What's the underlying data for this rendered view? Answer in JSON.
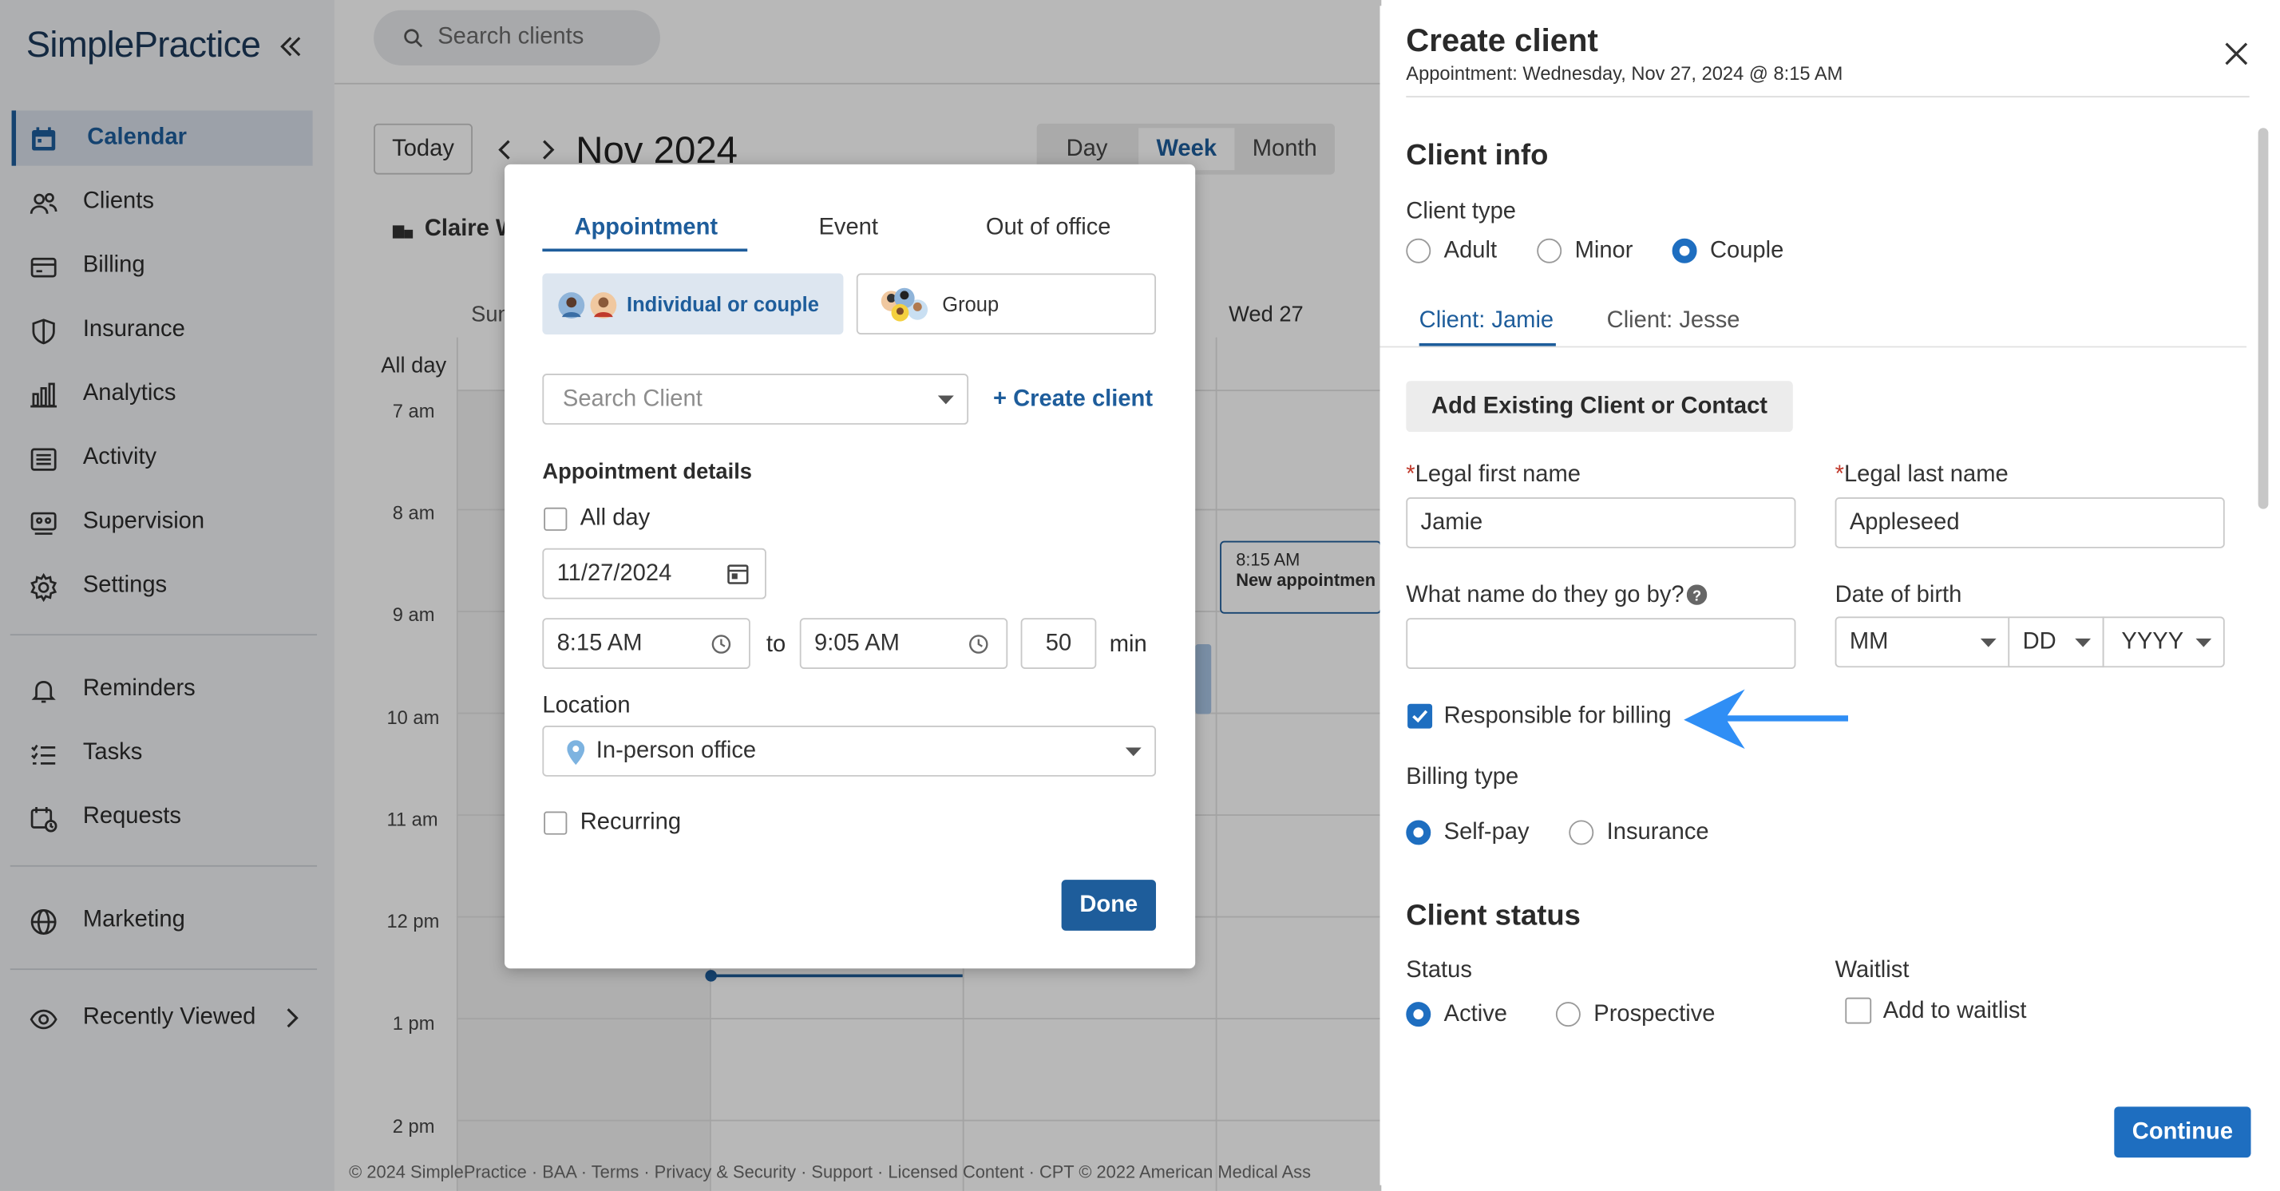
{
  "app": {
    "logo": "SimplePractice",
    "search_placeholder": "Search clients"
  },
  "sidebar": {
    "items": [
      {
        "label": "Calendar",
        "icon": "calendar-icon"
      },
      {
        "label": "Clients",
        "icon": "clients-icon"
      },
      {
        "label": "Billing",
        "icon": "billing-icon"
      },
      {
        "label": "Insurance",
        "icon": "shield-icon"
      },
      {
        "label": "Analytics",
        "icon": "analytics-icon"
      },
      {
        "label": "Activity",
        "icon": "activity-icon"
      },
      {
        "label": "Supervision",
        "icon": "supervision-icon"
      },
      {
        "label": "Settings",
        "icon": "gear-icon"
      },
      {
        "label": "Reminders",
        "icon": "bell-icon"
      },
      {
        "label": "Tasks",
        "icon": "tasks-icon"
      },
      {
        "label": "Requests",
        "icon": "requests-icon"
      },
      {
        "label": "Marketing",
        "icon": "globe-icon"
      },
      {
        "label": "Recently Viewed",
        "icon": "eye-icon"
      }
    ]
  },
  "calendar": {
    "today_label": "Today",
    "month_label": "Nov 2024",
    "views": [
      "Day",
      "Week",
      "Month"
    ],
    "active_view": "Week",
    "clinician": "Claire W",
    "day_sun": "Sun",
    "day_wed": "Wed 27",
    "all_day": "All day",
    "times": [
      "7 am",
      "8 am",
      "9 am",
      "10 am",
      "11 am",
      "12 pm",
      "1 pm",
      "2 pm"
    ],
    "event_time": "8:15 AM",
    "event_title": "New appointmen"
  },
  "footer": "© 2024 SimplePractice · BAA · Terms · Privacy & Security · Support · Licensed Content · CPT © 2022 American Medical Ass",
  "popup": {
    "tabs": [
      "Appointment",
      "Event",
      "Out of office"
    ],
    "type_individual": "Individual or couple",
    "type_group": "Group",
    "search_client_placeholder": "Search Client",
    "create_client": "+ Create client",
    "details_heading": "Appointment details",
    "all_day": "All day",
    "date": "11/27/2024",
    "start_time": "8:15 AM",
    "to": "to",
    "end_time": "9:05 AM",
    "duration": "50",
    "min": "min",
    "location_label": "Location",
    "location_value": "In-person office",
    "recurring": "Recurring",
    "done": "Done"
  },
  "drawer": {
    "title": "Create client",
    "subtitle": "Appointment: Wednesday, Nov 27, 2024 @ 8:15 AM",
    "client_info": "Client info",
    "client_type_label": "Client type",
    "client_types": [
      "Adult",
      "Minor",
      "Couple"
    ],
    "client_type_selected": "Couple",
    "client_tabs": [
      "Client: Jamie",
      "Client: Jesse"
    ],
    "add_existing": "Add Existing Client or Contact",
    "first_name_label": "Legal first name",
    "first_name_value": "Jamie",
    "last_name_label": "Legal last name",
    "last_name_value": "Appleseed",
    "go_by_label": "What name do they go by?",
    "go_by_value": "",
    "dob_label": "Date of birth",
    "dob_mm": "MM",
    "dob_dd": "DD",
    "dob_yyyy": "YYYY",
    "responsible_billing": "Responsible for billing",
    "billing_type_label": "Billing type",
    "billing_types": [
      "Self-pay",
      "Insurance"
    ],
    "billing_selected": "Self-pay",
    "client_status": "Client status",
    "status_label": "Status",
    "statuses": [
      "Active",
      "Prospective"
    ],
    "status_selected": "Active",
    "waitlist_label": "Waitlist",
    "add_to_waitlist": "Add to waitlist",
    "continue": "Continue"
  },
  "colors": {
    "brand_blue": "#1e5d9b",
    "accent_blue": "#1e6ec0",
    "arrow_blue": "#2f8ef5",
    "required_red": "#c0392b"
  }
}
